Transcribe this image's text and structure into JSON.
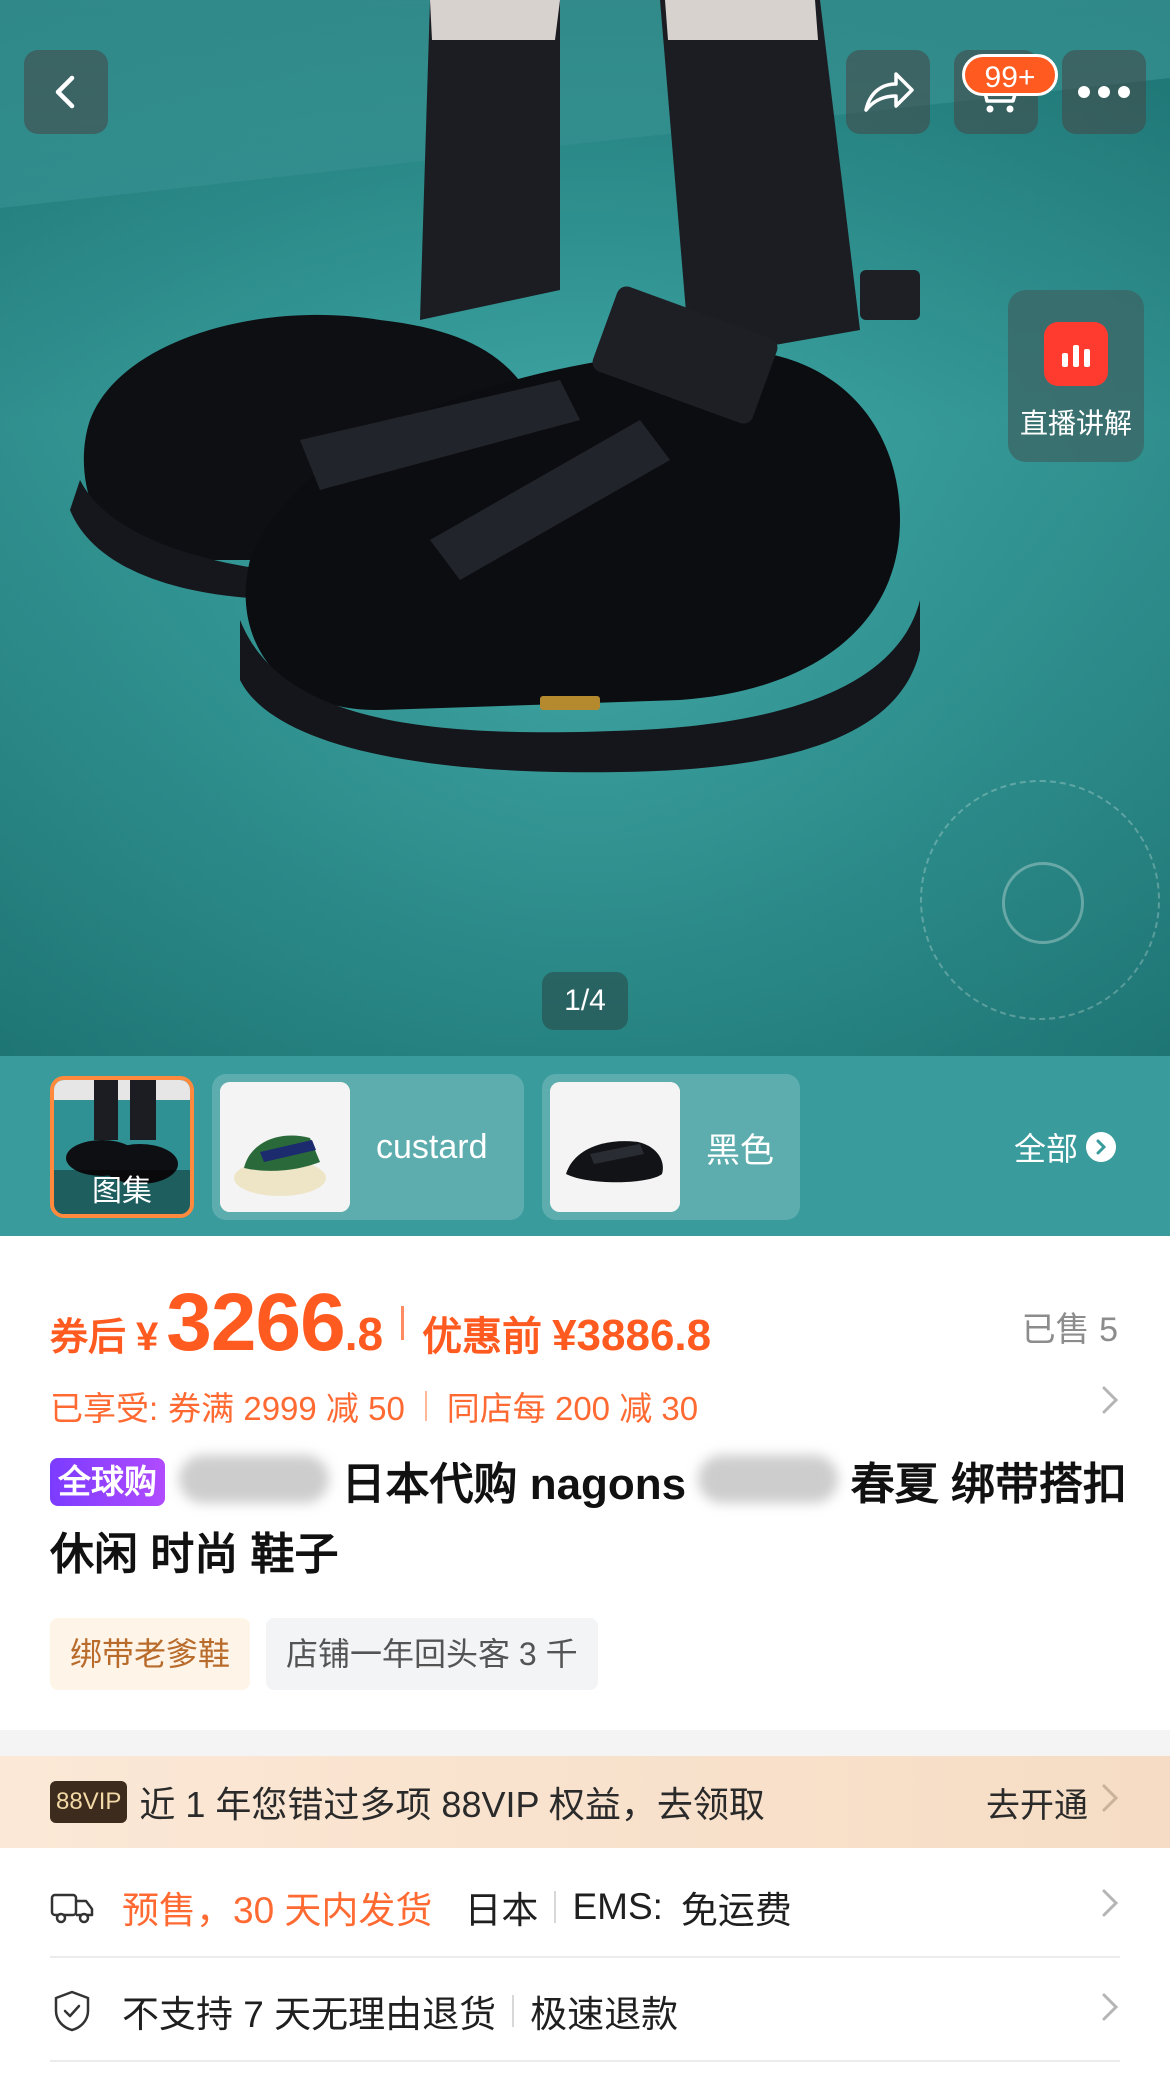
{
  "hero": {
    "page_indicator": "1/4",
    "cart_badge": "99+",
    "live_label": "直播讲解"
  },
  "sku": {
    "gallery_label": "图集",
    "options": [
      "custard",
      "黑色"
    ],
    "all_label": "全部"
  },
  "price": {
    "prefix": "券后",
    "currency": "¥",
    "integer": "3266",
    "decimal": ".8",
    "original_label": "优惠前",
    "original": "¥3886.8",
    "sold": "已售 5"
  },
  "promo": {
    "label": "已享受:",
    "coupon": "券满 2999 减 50",
    "store": "同店每 200 减 30"
  },
  "title": {
    "badge": "全球购",
    "part1": "日本代购 nagons",
    "part2": "春夏 绑带搭扣 休闲 时尚 鞋子"
  },
  "tags": [
    "绑带老爹鞋",
    "店铺一年回头客 3 千"
  ],
  "vip": {
    "badge": "88VIP",
    "text": "近 1 年您错过多项 88VIP 权益，去领取",
    "cta": "去开通"
  },
  "shipping": {
    "highlight": "预售，30 天内发货",
    "origin": "日本",
    "carrier": "EMS:",
    "fee": "免运费"
  },
  "returns": {
    "policy": "不支持 7 天无理由退货",
    "refund": "极速退款"
  },
  "colors": {
    "accent": "#ff5a1f",
    "teal": "#2b9593",
    "badge_purple": "#8a3dff"
  }
}
